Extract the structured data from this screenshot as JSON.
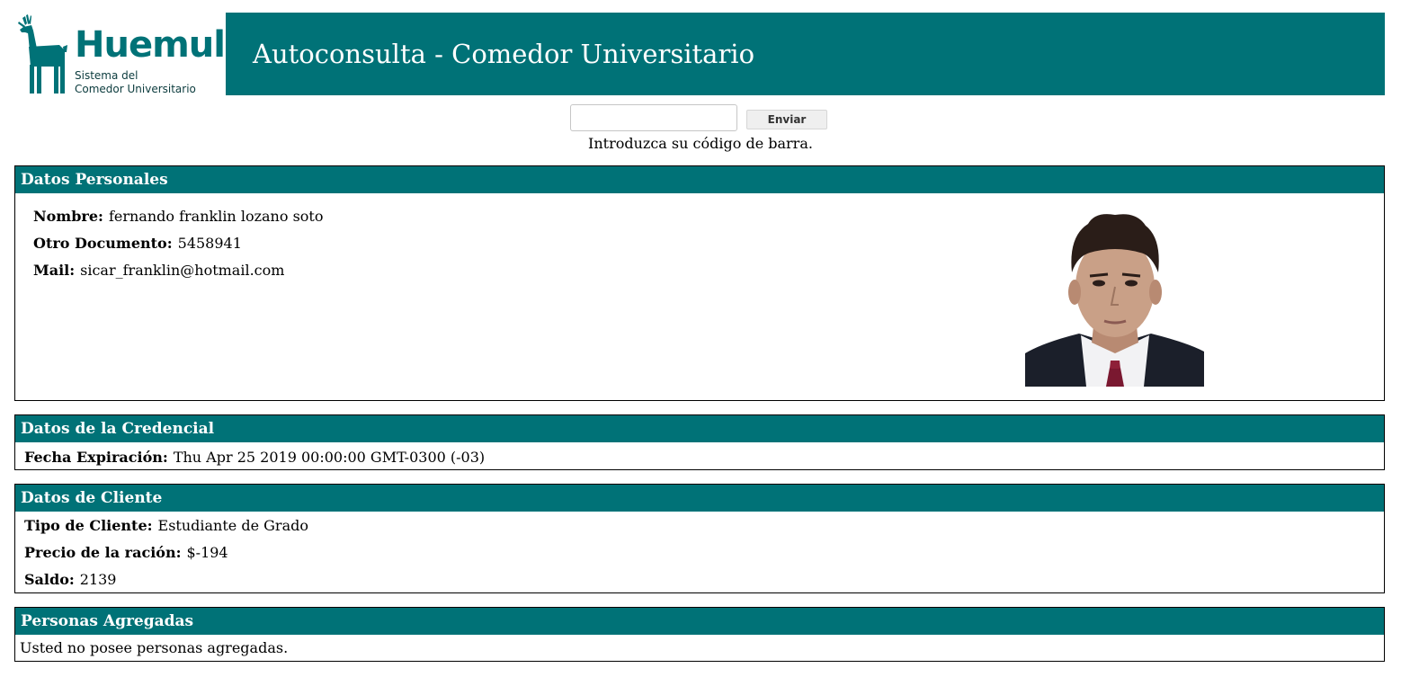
{
  "logo": {
    "brand": "Huemul",
    "subtitle_line1": "Sistema del",
    "subtitle_line2": "Comedor Universitario"
  },
  "header": {
    "title": "Autoconsulta - Comedor Universitario"
  },
  "barcode_form": {
    "input_value": "",
    "submit_label": "Enviar",
    "hint": "Introduzca su código de barra."
  },
  "personal": {
    "heading": "Datos Personales",
    "name_label": "Nombre:",
    "name_value": "fernando franklin lozano soto",
    "doc_label": "Otro Documento:",
    "doc_value": "5458941",
    "mail_label": "Mail:",
    "mail_value": "sicar_franklin@hotmail.com"
  },
  "credential": {
    "heading": "Datos de la Credencial",
    "expiry_label": "Fecha Expiración:",
    "expiry_value": "Thu Apr 25 2019 00:00:00 GMT-0300 (-03)"
  },
  "client": {
    "heading": "Datos de Cliente",
    "type_label": "Tipo de Cliente:",
    "type_value": "Estudiante de Grado",
    "price_label": "Precio de la ración:",
    "price_value": "$-194",
    "balance_label": "Saldo:",
    "balance_value": "2139"
  },
  "people": {
    "heading": "Personas Agregadas",
    "empty_message": "Usted no posee personas agregadas."
  },
  "colors": {
    "accent": "#007277"
  }
}
